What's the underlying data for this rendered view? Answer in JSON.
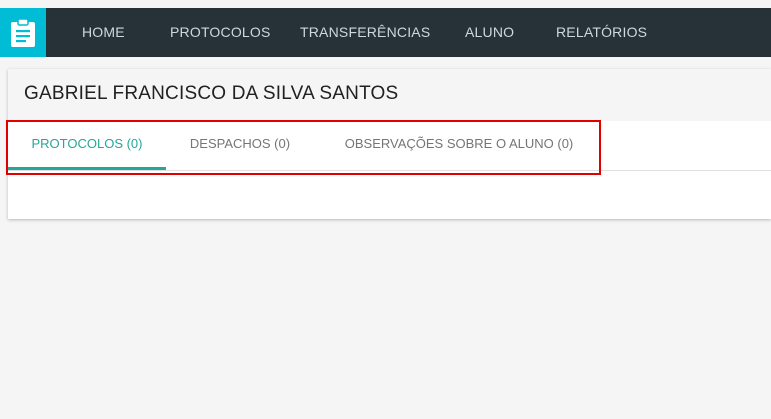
{
  "nav": {
    "logo_icon": "clipboard-icon",
    "items": [
      {
        "label": "HOME"
      },
      {
        "label": "PROTOCOLOS"
      },
      {
        "label": "TRANSFERÊNCIAS"
      },
      {
        "label": "ALUNO"
      },
      {
        "label": "RELATÓRIOS"
      }
    ]
  },
  "student": {
    "name": "GABRIEL FRANCISCO DA SILVA SANTOS"
  },
  "tabs": [
    {
      "label": "PROTOCOLOS (0)",
      "active": true
    },
    {
      "label": "DESPACHOS (0)",
      "active": false
    },
    {
      "label": "OBSERVAÇÕES SOBRE O ALUNO (0)",
      "active": false
    }
  ],
  "colors": {
    "navbar": "#263238",
    "logo": "#00bcd4",
    "accent": "#26a69a",
    "highlight": "#e00000"
  }
}
